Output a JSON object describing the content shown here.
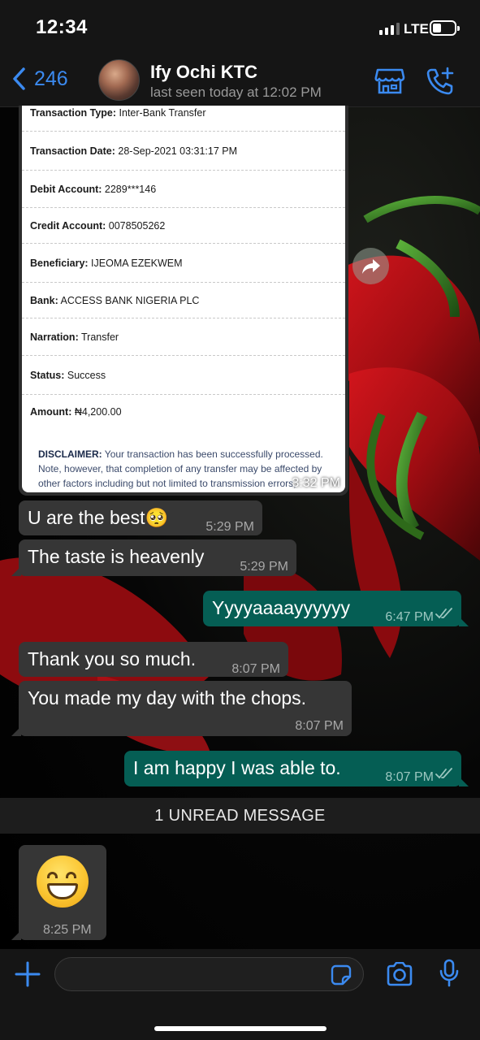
{
  "status_bar": {
    "time": "12:34",
    "network": "LTE"
  },
  "header": {
    "back_count": "246",
    "contact_name": "Ify Ochi KTC",
    "contact_status": "last seen today at 12:02 PM"
  },
  "receipt": {
    "rows": [
      {
        "label": "Transaction Type:",
        "value": "Inter-Bank Transfer"
      },
      {
        "label": "Transaction Date:",
        "value": "28-Sep-2021 03:31:17 PM"
      },
      {
        "label": "Debit Account:",
        "value": "2289***146"
      },
      {
        "label": "Credit Account:",
        "value": "0078505262"
      },
      {
        "label": "Beneficiary:",
        "value": "IJEOMA  EZEKWEM"
      },
      {
        "label": "Bank:",
        "value": "ACCESS BANK NIGERIA PLC"
      },
      {
        "label": "Narration:",
        "value": "Transfer"
      },
      {
        "label": "Status:",
        "value": "Success"
      },
      {
        "label": "Amount:",
        "value": "₦4,200.00"
      }
    ],
    "disclaimer_label": "DISCLAIMER:",
    "disclaimer_text": "Your transaction has been successfully processed. Note, however, that completion of any transfer may be affected by other factors including but not limited to transmission errors, incomplete information, fluctuations on the network/internet.",
    "time": "3:32 PM"
  },
  "messages": [
    {
      "direction": "in",
      "text": "U are the best🥺",
      "time": "5:29 PM"
    },
    {
      "direction": "in",
      "text": "The taste is heavenly",
      "time": "5:29 PM"
    },
    {
      "direction": "out",
      "text": "Yyyyaaaayyyyyy",
      "time": "6:47 PM",
      "read": true
    },
    {
      "direction": "in",
      "text": "Thank you so much.",
      "time": "8:07 PM"
    },
    {
      "direction": "in",
      "text": "You made my day with the chops.",
      "time": "8:07 PM"
    },
    {
      "direction": "out",
      "text": "I am happy I was able to.",
      "time": "8:07 PM",
      "read": true
    }
  ],
  "unread_divider": "1 UNREAD MESSAGE",
  "last_message": {
    "emoji": "grinning-face-with-smiling-eyes",
    "time": "8:25 PM"
  },
  "colors": {
    "accent": "#3b8af0",
    "outgoing_bubble": "#055e54",
    "incoming_bubble": "#363636"
  }
}
